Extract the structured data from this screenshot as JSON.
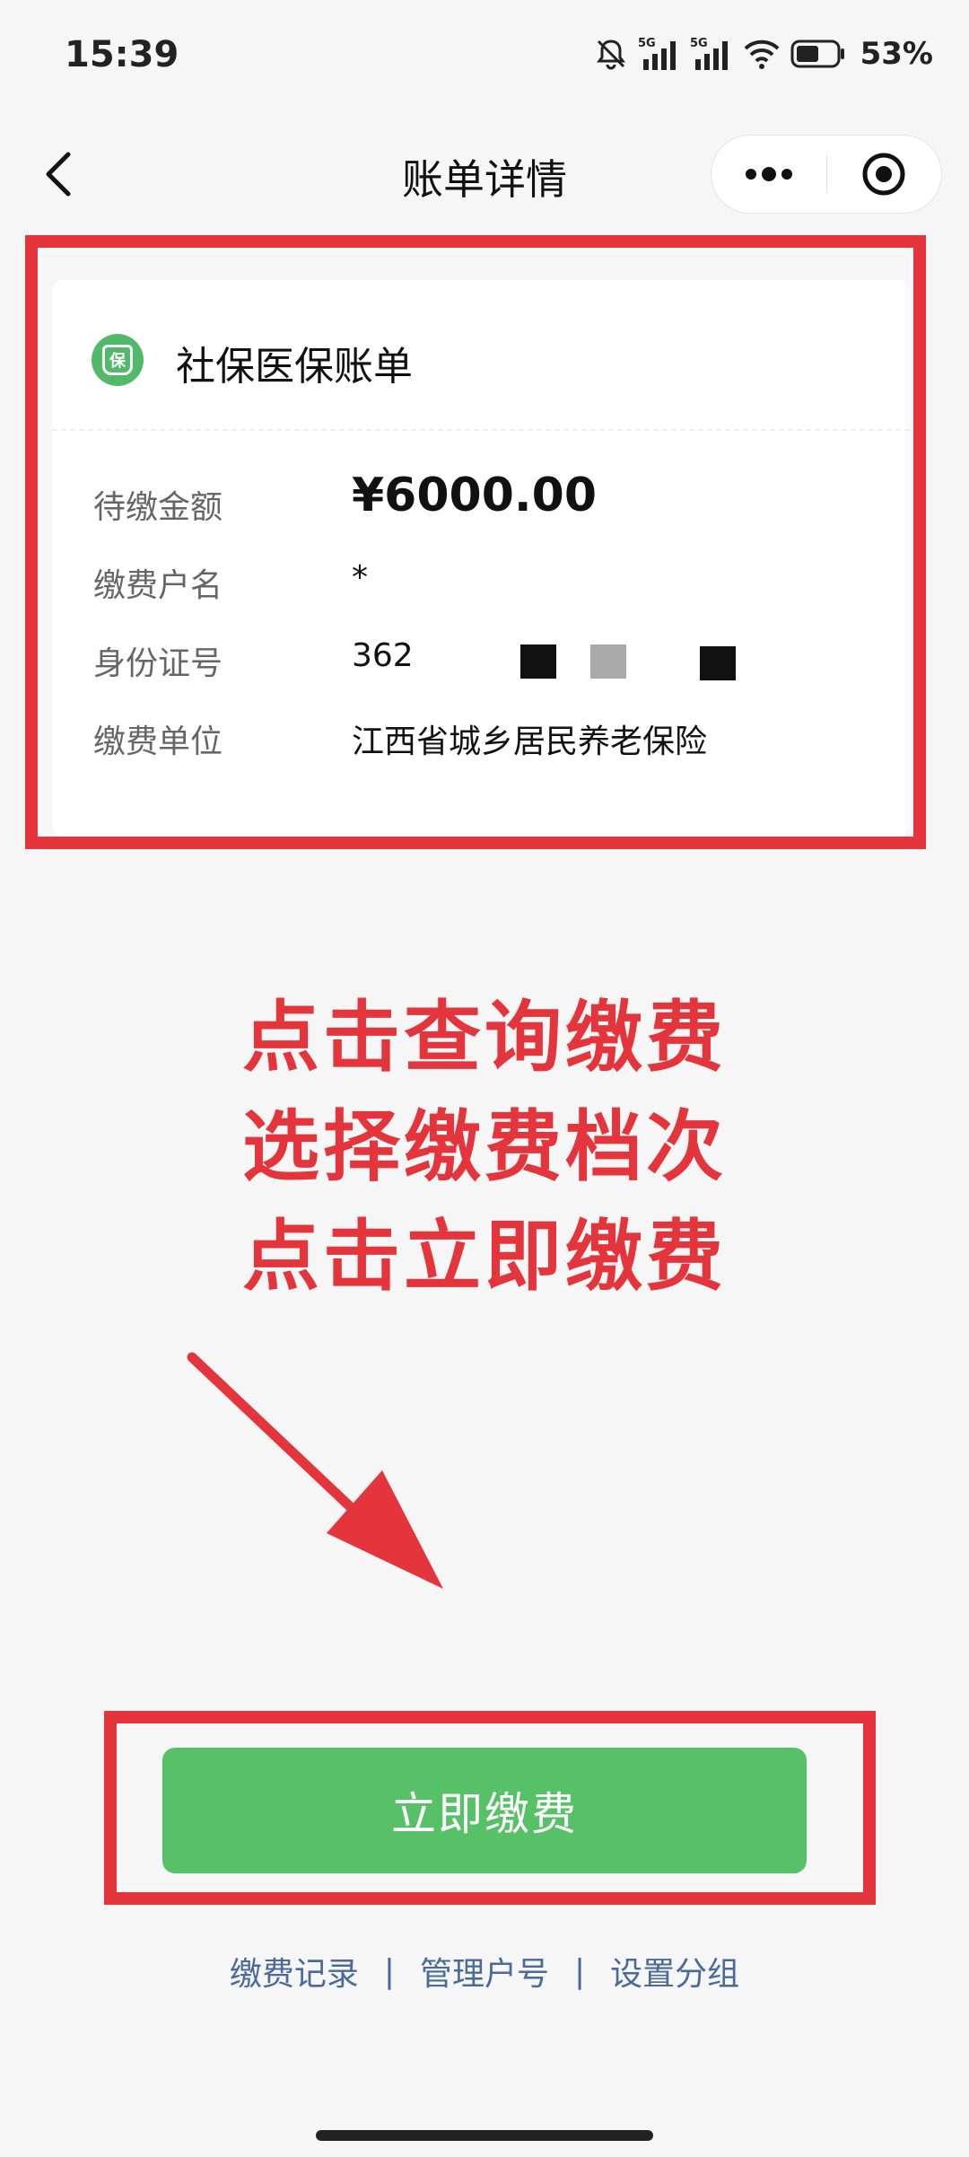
{
  "status_bar": {
    "time": "15:39",
    "battery_percent": "53%",
    "signal_1_label": "5G",
    "signal_2_label": "5G",
    "icons": [
      "mute-bell-icon",
      "signal-5g-icon",
      "signal-5g-icon",
      "wifi-icon",
      "battery-icon"
    ]
  },
  "nav": {
    "title": "账单详情",
    "icons": [
      "back-arrow-icon",
      "more-dots-icon",
      "close-target-icon"
    ]
  },
  "bill": {
    "title": "社保医保账单",
    "icon": "baobao-shield-icon",
    "icon_char": "保",
    "rows": [
      {
        "label": "待缴金额",
        "value": "¥6000.00"
      },
      {
        "label": "缴费户名",
        "value": "*"
      },
      {
        "label": "身份证号",
        "value": "362"
      },
      {
        "label": "缴费单位",
        "value": "江西省城乡居民养老保险"
      }
    ]
  },
  "instructions": [
    "点击查询缴费",
    "选择缴费档次",
    "点击立即缴费"
  ],
  "pay_button_label": "立即缴费",
  "links": [
    "缴费记录",
    "管理户号",
    "设置分组"
  ],
  "link_separator": "|",
  "colors": {
    "accent_red": "#e4353c",
    "button_green": "#57c168",
    "icon_green": "#52b96b",
    "link_blue": "#4a6a9a"
  }
}
